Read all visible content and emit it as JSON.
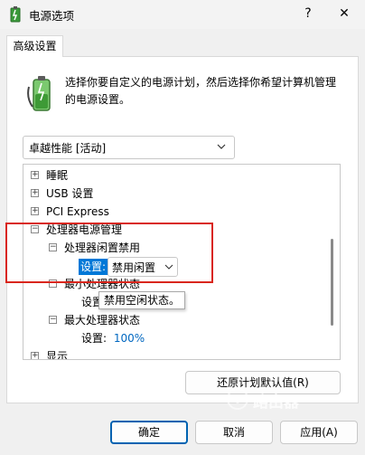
{
  "window": {
    "title": "电源选项",
    "help": "?",
    "close": "✕"
  },
  "tabs": [
    {
      "label": "高级设置"
    }
  ],
  "description": "选择你要自定义的电源计划，然后选择你希望计算机管理的电源设置。",
  "plan_select": {
    "value": "卓越性能 [活动]"
  },
  "tree": {
    "items": [
      {
        "label": "睡眠",
        "expanded": false
      },
      {
        "label": "USB 设置",
        "expanded": false
      },
      {
        "label": "PCI Express",
        "expanded": false
      },
      {
        "label": "处理器电源管理",
        "expanded": true
      },
      {
        "label": "处理器闲置禁用",
        "expanded": true
      },
      {
        "label": "最小处理器状态",
        "expanded": true
      },
      {
        "label": "最大处理器状态",
        "expanded": true
      },
      {
        "label": "显示",
        "expanded": false
      }
    ],
    "setting_label": "设置:",
    "setting_value": "禁用闲置",
    "min_state_label": "设置",
    "max_state_label": "设置:",
    "max_state_value": "100%",
    "tooltip": "禁用空闲状态。"
  },
  "buttons": {
    "restore_defaults": "还原计划默认值(R)",
    "ok": "确定",
    "cancel": "取消",
    "apply": "应用(A)"
  },
  "watermark": "路由器",
  "colors": {
    "selection": "#0078d7",
    "highlight_box": "#d9261c",
    "link_value": "#0067c0"
  }
}
